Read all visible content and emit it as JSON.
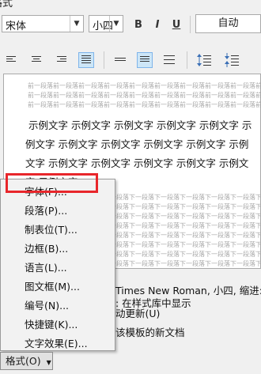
{
  "section_title": "格式",
  "toolbar": {
    "font_name": "宋体",
    "font_size": "小四",
    "bold": "B",
    "italic": "I",
    "underline": "U",
    "color": "自动"
  },
  "preview": {
    "prev_para_line": "前一段落前一段落前一段落前一段落前一段落前一段落前一段落前一段落前一段落前一段落前一段落前一段落前一段落前一段落",
    "sample_lines": [
      "示例文字 示例文字 示例文字 示例文字 示例文字 示",
      "例文字 示例文字 示例文字 示例文字 示例文字 示例",
      "文字 示例文字 示例文字 示例文字 示例文字 示例文",
      "字 示例文字"
    ],
    "next_para_line": "下一段落下一段落下一段落下一段落下一段落下一段落下一段落下一段落下一段落下一段落下一段落下一段落下一段落下一段落"
  },
  "description": {
    "line1": "Times New Roman, 小四, 缩进:",
    "line2": ": 在样式库中显示",
    "auto_update": "动更新(U)",
    "new_docs": "该模板的新文档"
  },
  "context_menu": {
    "items": [
      "字体(F)...",
      "段落(P)...",
      "制表位(T)...",
      "边框(B)...",
      "语言(L)...",
      "图文框(M)...",
      "编号(N)...",
      "快捷键(K)...",
      "文字效果(E)..."
    ]
  },
  "format_button": {
    "label": "格式(O)",
    "arrow": "▼"
  }
}
